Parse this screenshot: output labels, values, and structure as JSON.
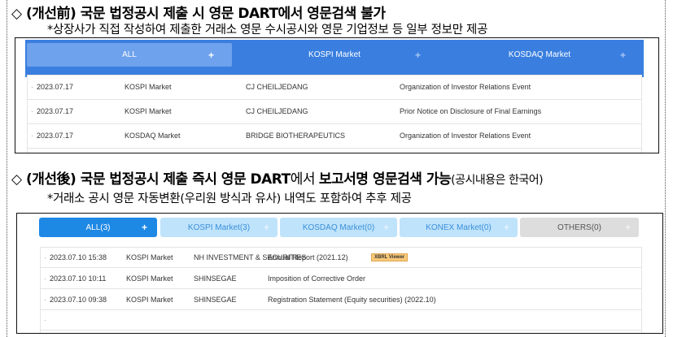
{
  "before": {
    "title_bold": "◇ (개선前) 국문 법정공시 제출 시 영문 DART에서 영문검색 불가",
    "subtitle": "*상장사가 직접 작성하여 제출한 거래소 영문 수시공시와 영문 기업정보 등 일부 정보만 제공",
    "tabs": [
      {
        "label": "ALL"
      },
      {
        "label": "KOSPI Market"
      },
      {
        "label": "KOSDAQ Market"
      }
    ],
    "rows": [
      {
        "date": "2023.07.17",
        "market": "KOSPI Market",
        "company": "CJ CHEILJEDANG",
        "title": "Organization of Investor Relations Event"
      },
      {
        "date": "2023.07.17",
        "market": "KOSPI Market",
        "company": "CJ CHEILJEDANG",
        "title": "Prior Notice on Disclosure of Final Earnings"
      },
      {
        "date": "2023.07.17",
        "market": "KOSDAQ Market",
        "company": "BRIDGE BIOTHERAPEUTICS",
        "title": "Organization of Investor Relations Event"
      }
    ]
  },
  "after": {
    "title_a": "◇ (개선後) 국문 법정공시 제출 즉시 영문 DART",
    "title_b": "에서 ",
    "title_c": "보고서명 영문검색 가능",
    "title_d": "(공시내용은 한국어)",
    "subtitle": "*거래소 공시 영문 자동변환(우리원 방식과 유사) 내역도 포함하여 추후 제공",
    "tabs": [
      {
        "label": "ALL(3)"
      },
      {
        "label": "KOSPI Market(3)"
      },
      {
        "label": "KOSDAQ Market(0)"
      },
      {
        "label": "KONEX Market(0)"
      },
      {
        "label": "OTHERS(0)"
      }
    ],
    "rows": [
      {
        "date": "2023.07.10 15:38",
        "market": "KOSPI Market",
        "company": "NH INVESTMENT & SECURITIES",
        "title": "Annual Report (2021.12)",
        "badge": "XBRL Viewer"
      },
      {
        "date": "2023.07.10 10:11",
        "market": "KOSPI Market",
        "company": "SHINSEGAE",
        "title": "Imposition of Corrective Order"
      },
      {
        "date": "2023.07.10 09:38",
        "market": "KOSPI Market",
        "company": "SHINSEGAE",
        "title": "Registration Statement (Equity securities) (2022.10)"
      }
    ]
  },
  "plus_glyph": "+",
  "bullet": "·",
  "colors": {
    "bar_blue": "#3a7fe0",
    "all_tab_active": "#1e88e5",
    "market_tab": "#bfe3fb",
    "others_tab": "#dddddd",
    "badge": "#f8c87a"
  }
}
